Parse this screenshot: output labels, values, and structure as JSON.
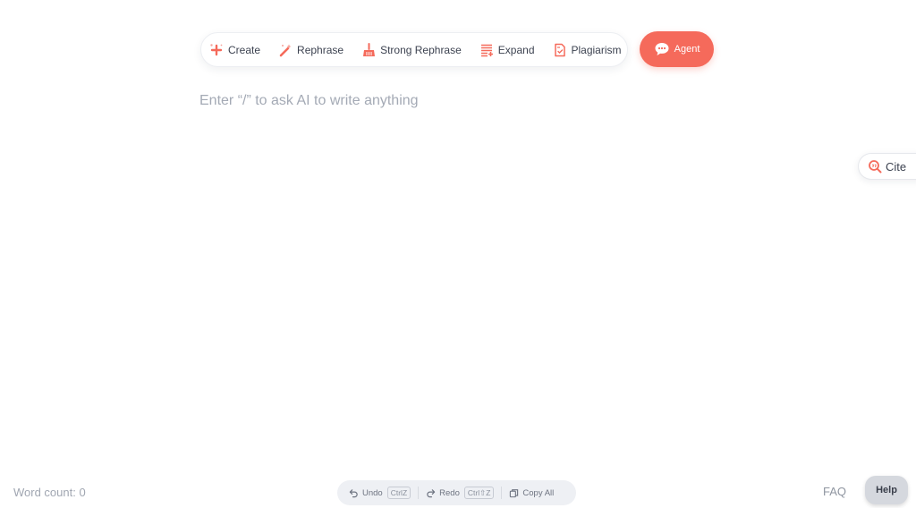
{
  "toolbar": {
    "tools": [
      {
        "label": "Create",
        "icon": "sparkle-plus-icon"
      },
      {
        "label": "Rephrase",
        "icon": "magic-wand-icon"
      },
      {
        "label": "Strong Rephrase",
        "icon": "broom-icon"
      },
      {
        "label": "Expand",
        "icon": "text-expand-icon"
      },
      {
        "label": "Plagiarism",
        "icon": "document-check-icon"
      }
    ]
  },
  "agent": {
    "label": "Agent",
    "icon": "chat-bubble-icon"
  },
  "editor": {
    "placeholder": "Enter “/” to ask AI to write anything"
  },
  "cite": {
    "label": "Cite",
    "icon": "search-quote-icon"
  },
  "footer": {
    "word_count": "Word count: 0",
    "undo": {
      "label": "Undo",
      "shortcut": "CtrlZ"
    },
    "redo": {
      "label": "Redo",
      "shortcut": "Ctrl⇧Z"
    },
    "copy_all": {
      "label": "Copy All"
    },
    "faq": "FAQ",
    "help": "Help"
  },
  "colors": {
    "accent": "#f56a5b",
    "placeholder": "#a4aab5",
    "bar_bg": "#eef0f4"
  }
}
